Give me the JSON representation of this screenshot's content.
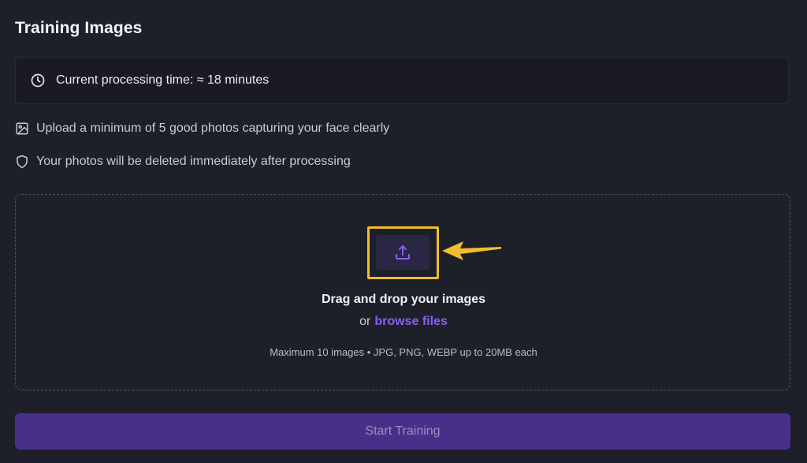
{
  "section": {
    "title": "Training Images"
  },
  "processing": {
    "icon": "clock-icon",
    "text": "Current processing time: ≈ 18 minutes"
  },
  "tips": [
    {
      "icon": "image-icon",
      "text": "Upload a minimum of 5 good photos capturing your face clearly"
    },
    {
      "icon": "shield-icon",
      "text": "Your photos will be deleted immediately after processing"
    }
  ],
  "dropzone": {
    "upload_icon": "upload-icon",
    "title": "Drag and drop your images",
    "or_text": "or",
    "browse_label": "browse files",
    "limits": "Maximum 10 images • JPG, PNG, WEBP up to 20MB each"
  },
  "annotation": {
    "highlight_color": "#f2be2b",
    "arrow_color": "#f2be2b"
  },
  "actions": {
    "start_label": "Start Training"
  },
  "colors": {
    "background": "#1e2029",
    "accent": "#8a5cf6",
    "button_disabled": "#4a2f8a"
  }
}
